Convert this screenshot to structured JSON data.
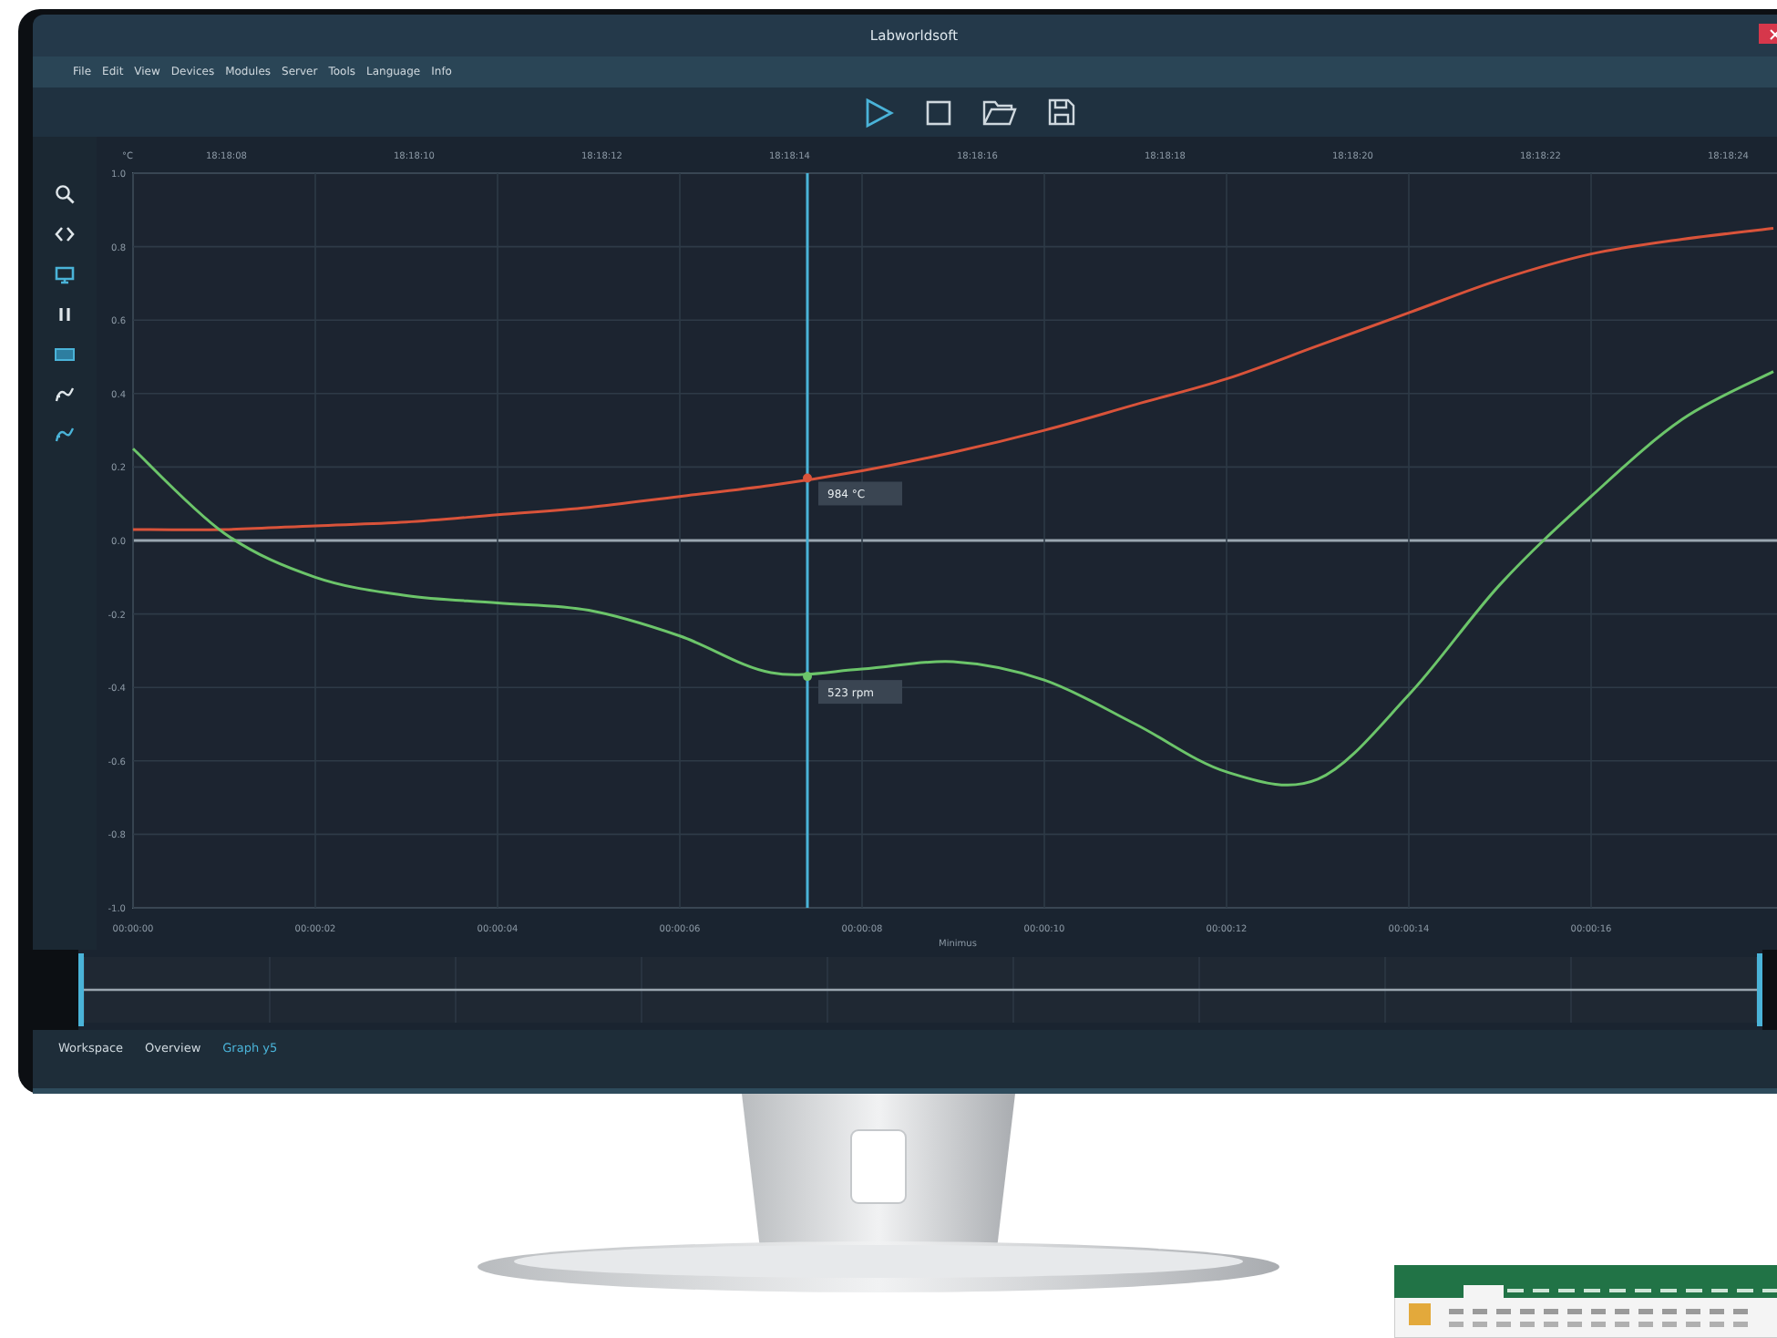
{
  "window": {
    "title": "Labworldsoft"
  },
  "menu": [
    "File",
    "Edit",
    "View",
    "Devices",
    "Modules",
    "Server",
    "Tools",
    "Language",
    "Info"
  ],
  "tools": [
    {
      "kind": "search",
      "selected": false
    },
    {
      "kind": "arrows",
      "selected": false
    },
    {
      "kind": "monitor",
      "selected": true
    },
    {
      "kind": "pause",
      "selected": false
    },
    {
      "kind": "rect",
      "selected": true
    },
    {
      "kind": "curve",
      "selected": false
    },
    {
      "kind": "curve",
      "selected": true
    }
  ],
  "graph": {
    "unit": "°C",
    "top_ticks": [
      "18:18:08",
      "18:18:10",
      "18:18:12",
      "18:18:14",
      "18:18:16",
      "18:18:18",
      "18:18:20",
      "18:18:22",
      "18:18:24"
    ],
    "chart_data": {
      "type": "line",
      "xlabel": "Minimus",
      "x": [
        0,
        1,
        2,
        3,
        4,
        5,
        6,
        7,
        8,
        9,
        10,
        11,
        12,
        13,
        14,
        15,
        16,
        17,
        18
      ],
      "grid": true,
      "ref_lines": [
        {
          "axis": "x",
          "value": 7.4
        }
      ],
      "series": [
        {
          "color": "#d9533a",
          "values": [
            0.03,
            0.03,
            0.04,
            0.05,
            0.07,
            0.09,
            0.12,
            0.15,
            0.19,
            0.24,
            0.3,
            0.37,
            0.44,
            0.53,
            0.62,
            0.71,
            0.78,
            0.82,
            0.85
          ]
        },
        {
          "color": "#6cc56a",
          "values": [
            0.25,
            0.02,
            -0.1,
            -0.15,
            -0.17,
            -0.19,
            -0.26,
            -0.36,
            -0.35,
            -0.33,
            -0.38,
            -0.5,
            -0.63,
            -0.65,
            -0.42,
            -0.12,
            0.12,
            0.33,
            0.46
          ]
        }
      ],
      "xlim": [
        0,
        18.1
      ],
      "ylim": [
        -1,
        1
      ],
      "xticks": [
        {
          "value": 0,
          "label": "00:00:00"
        },
        {
          "value": 2,
          "label": "00:00:02"
        },
        {
          "value": 4,
          "label": "00:00:04"
        },
        {
          "value": 6,
          "label": "00:00:06"
        },
        {
          "value": 8,
          "label": "00:00:08"
        },
        {
          "value": 10,
          "label": "00:00:10"
        },
        {
          "value": 12,
          "label": "00:00:12"
        },
        {
          "value": 14,
          "label": "00:00:14"
        },
        {
          "value": 16,
          "label": "00:00:16"
        }
      ],
      "yticks": [
        {
          "value": 1,
          "label": "1.0"
        },
        {
          "value": 0.8,
          "label": "0.8"
        },
        {
          "value": 0.6,
          "label": "0.6"
        },
        {
          "value": 0.4,
          "label": "0.4"
        },
        {
          "value": 0.2,
          "label": "0.2"
        },
        {
          "value": 0,
          "label": "0.0"
        },
        {
          "value": -0.2,
          "label": "-0.2"
        },
        {
          "value": -0.4,
          "label": "-0.4"
        },
        {
          "value": -0.6,
          "label": "-0.6"
        },
        {
          "value": -0.8,
          "label": "-0.8"
        },
        {
          "value": -1,
          "label": "-1.0"
        }
      ],
      "annotations": [
        {
          "x": 7.4,
          "y": 0.17,
          "text": "984 °C"
        },
        {
          "x": 7.4,
          "y": -0.37,
          "text": "523 rpm"
        }
      ]
    }
  },
  "tabs": [
    {
      "label": "Workspace",
      "selected": false
    },
    {
      "label": "Overview",
      "selected": false
    },
    {
      "label": "Graph y5",
      "selected": true
    }
  ]
}
